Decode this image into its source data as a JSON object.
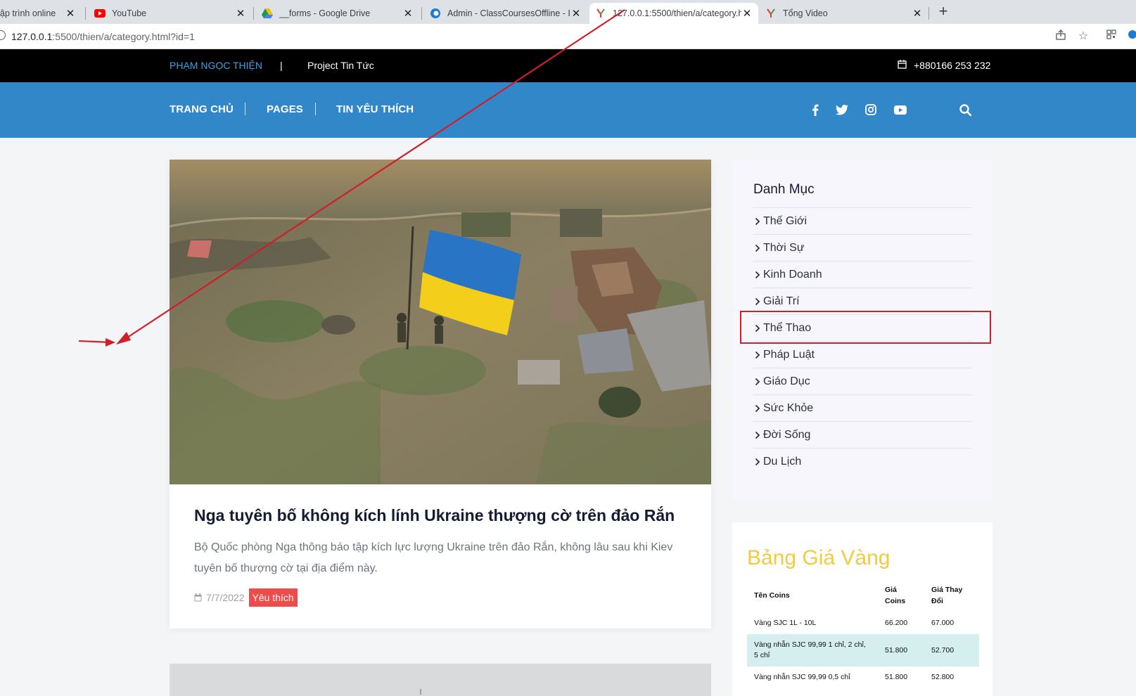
{
  "browser": {
    "tabs": [
      {
        "title": "ập trình online",
        "icon": "generic-page-icon"
      },
      {
        "title": "YouTube",
        "icon": "youtube-icon"
      },
      {
        "title": "__forms - Google Drive",
        "icon": "google-drive-icon"
      },
      {
        "title": "Admin - ClassCoursesOffline - Ini",
        "icon": "edge-icon"
      },
      {
        "title": "127.0.0.1:5500/thien/a/category.h",
        "icon": "site-logo-icon",
        "active": true
      },
      {
        "title": "Tổng Video",
        "icon": "site-logo-icon"
      }
    ],
    "address": {
      "host": "127.0.0.1",
      "path": ":5500/thien/a/category.html?id=1"
    }
  },
  "topbar": {
    "brand": "PHẠM NGỌC THIỆN",
    "separator": "|",
    "project": "Project Tin Tức",
    "phone": "+880166 253 232"
  },
  "nav": {
    "items": [
      "TRANG CHỦ",
      "PAGES",
      "TIN YÊU THÍCH"
    ],
    "social": [
      "facebook-icon",
      "twitter-icon",
      "instagram-icon",
      "youtube-icon"
    ],
    "search": "search-icon"
  },
  "article": {
    "title": "Nga tuyên bố không kích lính Ukraine thượng cờ trên đảo Rắn",
    "description": "Bộ Quốc phòng Nga thông báo tập kích lực lượng Ukraine trên đảo Rắn, không lâu sau khi Kiev tuyên bố thượng cờ tại địa điểm này.",
    "date": "7/7/2022",
    "tag": "Yêu thích"
  },
  "categories": {
    "title": "Danh Mục",
    "items": [
      "Thế Giới",
      "Thời Sự",
      "Kinh Doanh",
      "Giải Trí",
      "Thể Thao",
      "Pháp Luật",
      "Giáo Dục",
      "Sức Khỏe",
      "Đời Sống",
      "Du Lịch"
    ],
    "highlighted": "Thể Thao"
  },
  "gold": {
    "title": "Bảng Giá Vàng",
    "headers": [
      "Tên Coins",
      "Giá Coins",
      "Giá Thay Đổi"
    ],
    "rows": [
      [
        "Vàng SJC 1L - 10L",
        "66.200",
        "67.000"
      ],
      [
        "Vàng nhẫn SJC 99,99 1 chỉ, 2 chỉ, 5 chỉ",
        "51.800",
        "52.700"
      ],
      [
        "Vàng nhẫn SJC 99,99 0,5 chỉ",
        "51.800",
        "52.800"
      ]
    ]
  },
  "colors": {
    "topbar": "#000000",
    "navbar": "#3187c8",
    "brand": "#3ea0e4",
    "tag": "#ee4b4b",
    "gold_title": "#f4cb3c",
    "annotation": "#d01e2a"
  }
}
